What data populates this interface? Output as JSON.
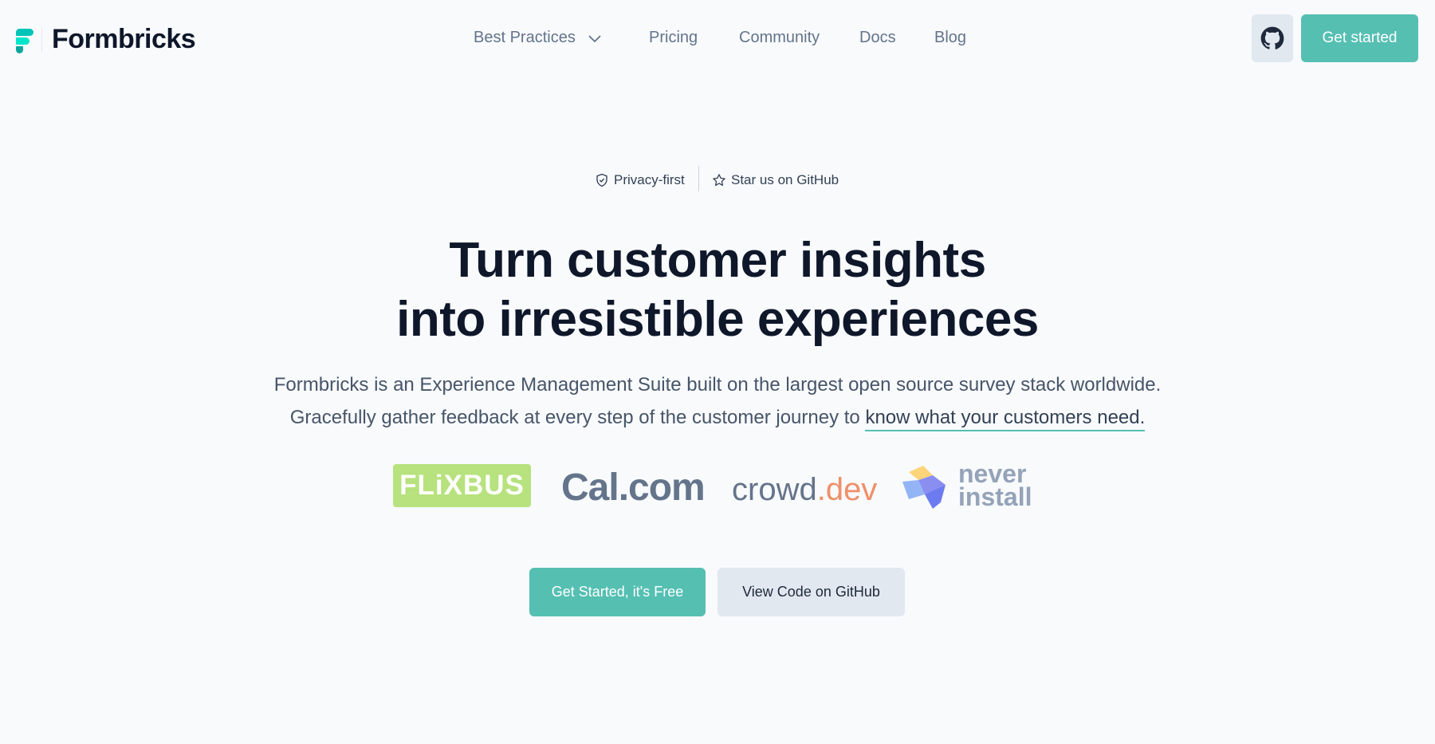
{
  "brand": {
    "name": "Formbricks"
  },
  "nav": {
    "items": [
      {
        "label": "Best Practices",
        "has_dropdown": true,
        "icon": "chevron-down-icon"
      },
      {
        "label": "Pricing"
      },
      {
        "label": "Community"
      },
      {
        "label": "Docs"
      },
      {
        "label": "Blog"
      }
    ]
  },
  "header": {
    "github_icon": "github-icon",
    "cta_label": "Get started"
  },
  "badges": {
    "privacy": {
      "label": "Privacy-first",
      "icon": "shield-check-icon"
    },
    "star": {
      "label": "Star us on GitHub",
      "icon": "star-icon"
    }
  },
  "hero": {
    "headline_line1": "Turn customer insights",
    "headline_line2": "into irresistible experiences",
    "subtitle_line1": "Formbricks is an Experience Management Suite built on the largest open source survey stack worldwide.",
    "subtitle_line2_pre": "Gracefully gather feedback at every step of the customer journey to ",
    "subtitle_line2_highlight": "know what your customers need."
  },
  "customer_logos": {
    "flixbus": "FLiXBUS",
    "calcom": "Cal.com",
    "crowddev_a": "crowd",
    "crowddev_b": ".dev",
    "neverinstall_line1": "never",
    "neverinstall_line2": "install"
  },
  "cta": {
    "primary_label": "Get Started, it's Free",
    "secondary_label": "View Code on GitHub"
  },
  "colors": {
    "accent": "#55bfb2",
    "background": "#f8fafc",
    "heading": "#0f172a",
    "muted": "#64748b"
  }
}
